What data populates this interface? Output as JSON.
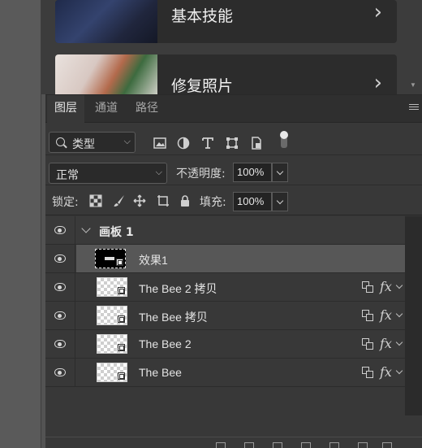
{
  "learn": {
    "cards": [
      {
        "title": "基本技能",
        "chevron": "chevron-right-icon"
      },
      {
        "title": "修复照片",
        "chevron": "chevron-right-icon"
      }
    ]
  },
  "layers_panel": {
    "tabs": [
      {
        "label": "图层",
        "active": true
      },
      {
        "label": "通道",
        "active": false
      },
      {
        "label": "路径",
        "active": false
      }
    ],
    "filter": {
      "kind_label": "类型",
      "icons": [
        "image-filter-icon",
        "adjustment-filter-icon",
        "type-filter-icon",
        "shape-filter-icon",
        "smart-object-filter-icon",
        "filter-toggle-icon"
      ]
    },
    "blend": {
      "mode": "正常",
      "opacity_label": "不透明度:",
      "opacity_value": "100%"
    },
    "lock": {
      "label": "锁定:",
      "icons": [
        "lock-transparent-pixels-icon",
        "lock-image-pixels-icon",
        "lock-position-icon",
        "lock-artboard-icon",
        "lock-all-icon"
      ],
      "fill_label": "填充:",
      "fill_value": "100%"
    },
    "layers": [
      {
        "name": "画板 1",
        "type": "artboard-group"
      },
      {
        "name": "效果1",
        "type": "smart-object",
        "selected": true
      },
      {
        "name": "The Bee 2 拷贝",
        "type": "smart-object",
        "fx": "fx"
      },
      {
        "name": "The Bee 拷贝",
        "type": "smart-object",
        "fx": "fx"
      },
      {
        "name": "The Bee 2",
        "type": "smart-object",
        "fx": "fx"
      },
      {
        "name": "The Bee",
        "type": "smart-object",
        "fx": "fx"
      }
    ]
  },
  "colors": {
    "panel_bg": "#383838",
    "selected_row": "#575757",
    "tabbar_bg": "#2f2f2f"
  }
}
